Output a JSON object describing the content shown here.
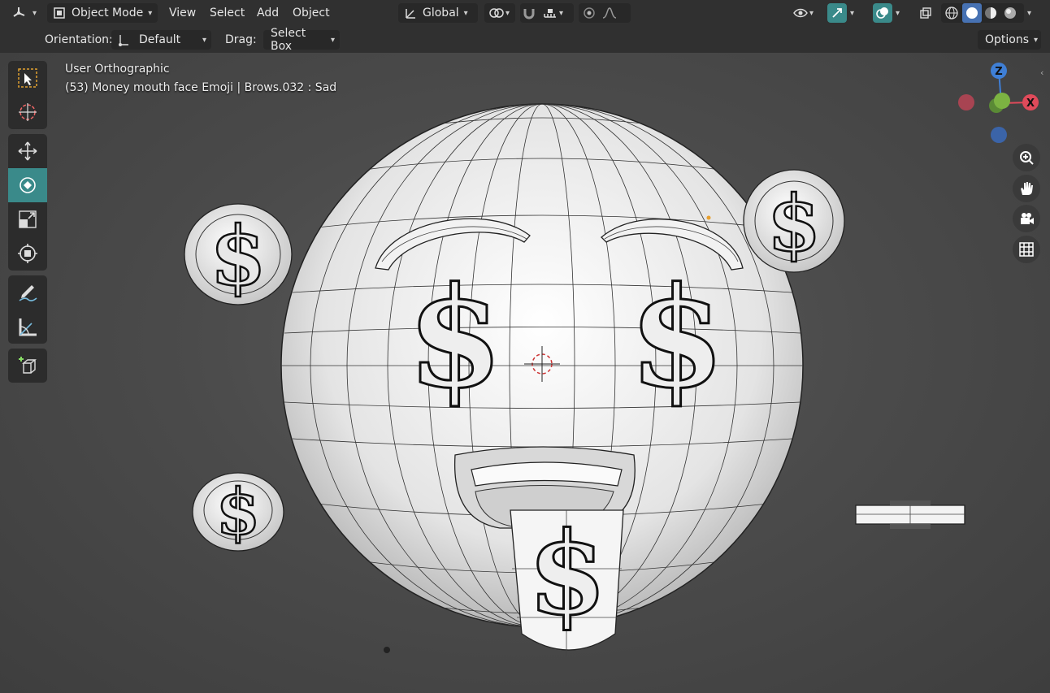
{
  "header": {
    "editor_type_icon": "viewport-axis-icon",
    "mode": {
      "label": "Object Mode",
      "icon": "object-mode-icon"
    },
    "menus": [
      "View",
      "Select",
      "Add",
      "Object"
    ],
    "transform_orientation": {
      "label": "Global",
      "icon": "transform-orientation-icon"
    },
    "pivot_icon": "pivot-point-icon",
    "snap_icon": "snap-magnet-icon",
    "snap_target_icon": "snap-increment-icon",
    "proportional_edit_icon": "proportional-edit-icon",
    "falloff_icon": "falloff-curve-icon",
    "visibility_icon": "eye-icon",
    "gizmo_icon": "gizmo-icon",
    "overlays_icon": "overlays-icon",
    "xray_icon": "xray-icon",
    "shading_modes": [
      "wireframe-shading-icon",
      "solid-shading-icon",
      "material-shading-icon",
      "rendered-shading-icon"
    ],
    "accent_color": "#4772b3",
    "active_toggle_color": "#3a8a8a"
  },
  "subheader": {
    "orientation_label": "Orientation:",
    "orientation_value": "Default",
    "drag_label": "Drag:",
    "drag_value": "Select Box",
    "options_label": "Options"
  },
  "toolbar": {
    "groups": [
      [
        "select-box-icon",
        "cursor-icon"
      ],
      [
        "move-icon",
        "rotate-icon",
        "scale-icon",
        "transform-icon"
      ],
      [
        "annotate-icon",
        "measure-icon"
      ],
      [
        "add-cube-icon"
      ]
    ],
    "active_tool": "rotate-icon"
  },
  "viewport": {
    "view_name": "User Orthographic",
    "object_info": "(53) Money mouth face Emoji | Brows.032 : Sad",
    "axes": {
      "x": "X",
      "y": "Y",
      "z": "Z",
      "x_color": "#e04a5a",
      "y_color": "#7cb342",
      "z_color": "#3f7fd6"
    },
    "nav_buttons": [
      "zoom-icon",
      "pan-hand-icon",
      "camera-icon",
      "grid-icon"
    ]
  }
}
